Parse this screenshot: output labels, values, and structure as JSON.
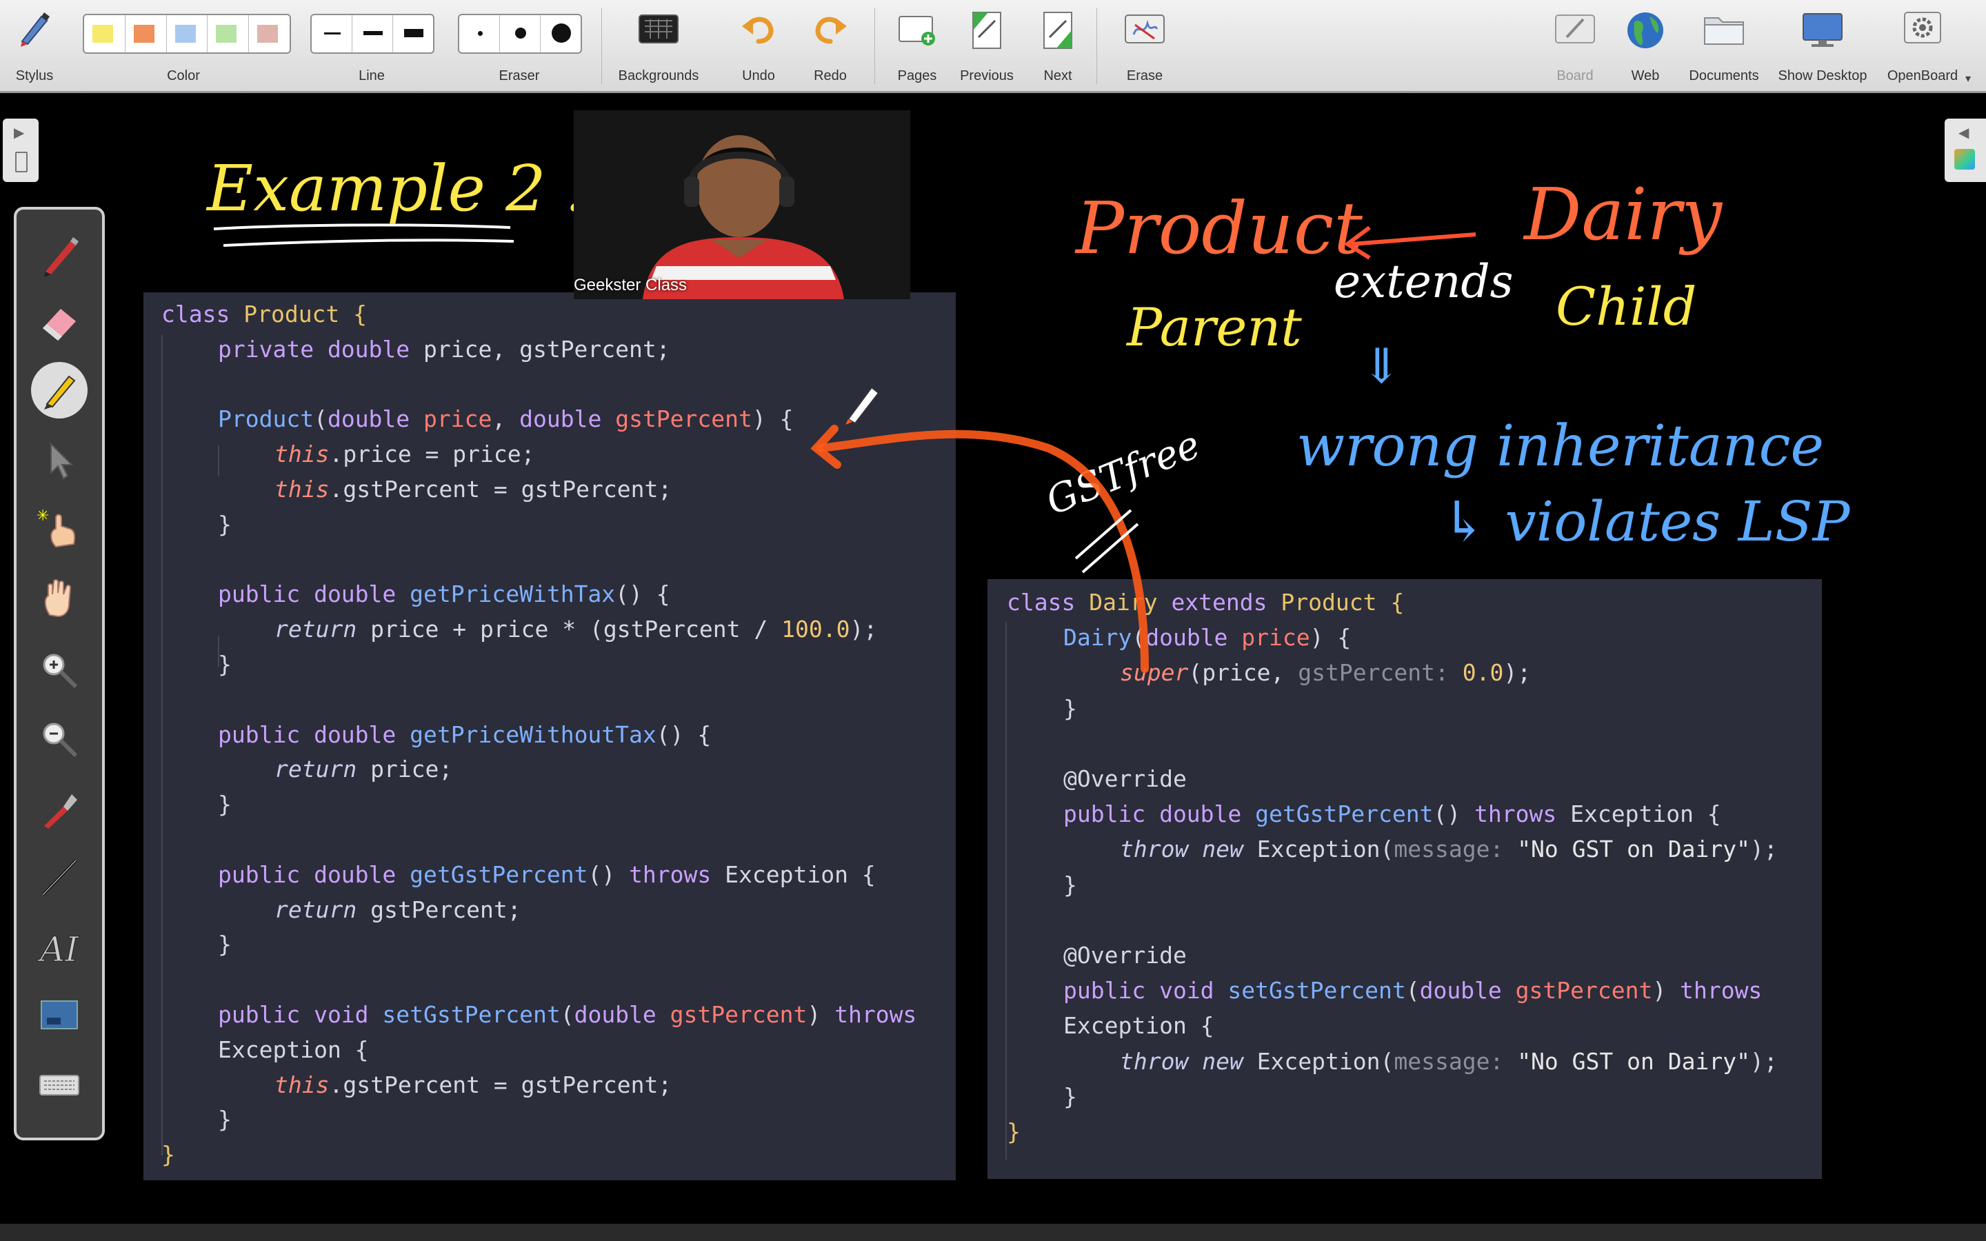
{
  "toolbar": {
    "stylus": "Stylus",
    "color": "Color",
    "line": "Line",
    "eraser": "Eraser",
    "backgrounds": "Backgrounds",
    "undo": "Undo",
    "redo": "Redo",
    "pages": "Pages",
    "previous": "Previous",
    "next": "Next",
    "erase": "Erase",
    "board": "Board",
    "web": "Web",
    "documents": "Documents",
    "show_desktop": "Show Desktop",
    "openboard": "OpenBoard",
    "colors": [
      "#f7ea6b",
      "#f0905a",
      "#a9c8f0",
      "#b7e4a4",
      "#e0b4ac"
    ]
  },
  "palette": {
    "tools": [
      "pen",
      "eraser",
      "marker",
      "selector",
      "laser-pointer",
      "hand",
      "zoom-in",
      "zoom-out",
      "capture",
      "line",
      "text",
      "screenshot",
      "keyboard"
    ]
  },
  "webcam": {
    "label": "Geekster Class"
  },
  "handwriting": {
    "title": "Example 2 :->",
    "product": "Product",
    "dairy": "Dairy",
    "extends": "extends",
    "parent": "Parent",
    "child": "Child",
    "down_arrow": "⇓",
    "wrong": "wrong inheritance",
    "violates": "↳ violates LSP",
    "gst_free": "GSTfree"
  },
  "code_left": {
    "lines": [
      {
        "indent": 0,
        "tokens": [
          [
            "kw",
            "class "
          ],
          [
            "ty",
            "Product"
          ],
          [
            "ty",
            " {"
          ]
        ]
      },
      {
        "indent": 1,
        "tokens": [
          [
            "kw",
            "private double "
          ],
          [
            "",
            "price, gstPercent;"
          ]
        ]
      },
      {
        "indent": 0,
        "tokens": []
      },
      {
        "indent": 1,
        "tokens": [
          [
            "fn",
            "Product"
          ],
          [
            "",
            "("
          ],
          [
            "kw",
            "double "
          ],
          [
            "pa",
            "price"
          ],
          [
            "",
            ", "
          ],
          [
            "kw",
            "double "
          ],
          [
            "pa",
            "gstPercent"
          ],
          [
            "",
            ") {"
          ]
        ]
      },
      {
        "indent": 2,
        "tokens": [
          [
            "it",
            "this"
          ],
          [
            "",
            ".price = price;"
          ]
        ]
      },
      {
        "indent": 2,
        "tokens": [
          [
            "it",
            "this"
          ],
          [
            "",
            ".gstPercent = gstPercent;"
          ]
        ]
      },
      {
        "indent": 1,
        "tokens": [
          [
            "",
            "}"
          ]
        ]
      },
      {
        "indent": 0,
        "tokens": []
      },
      {
        "indent": 1,
        "tokens": [
          [
            "kw",
            "public double "
          ],
          [
            "fn",
            "getPriceWithTax"
          ],
          [
            "",
            "() {"
          ]
        ]
      },
      {
        "indent": 2,
        "tokens": [
          [
            "ret",
            "return "
          ],
          [
            "",
            "price + price * (gstPercent / "
          ],
          [
            "num",
            "100.0"
          ],
          [
            "",
            ");"
          ]
        ]
      },
      {
        "indent": 1,
        "tokens": [
          [
            "",
            "}"
          ]
        ]
      },
      {
        "indent": 0,
        "tokens": []
      },
      {
        "indent": 1,
        "tokens": [
          [
            "kw",
            "public double "
          ],
          [
            "fn",
            "getPriceWithoutTax"
          ],
          [
            "",
            "() {"
          ]
        ]
      },
      {
        "indent": 2,
        "tokens": [
          [
            "ret",
            "return "
          ],
          [
            "",
            "price;"
          ]
        ]
      },
      {
        "indent": 1,
        "tokens": [
          [
            "",
            "}"
          ]
        ]
      },
      {
        "indent": 0,
        "tokens": []
      },
      {
        "indent": 1,
        "tokens": [
          [
            "kw",
            "public double "
          ],
          [
            "fn",
            "getGstPercent"
          ],
          [
            "",
            "() "
          ],
          [
            "kw",
            "throws "
          ],
          [
            "",
            "Exception {"
          ]
        ]
      },
      {
        "indent": 2,
        "tokens": [
          [
            "ret",
            "return "
          ],
          [
            "",
            "gstPercent;"
          ]
        ]
      },
      {
        "indent": 1,
        "tokens": [
          [
            "",
            "}"
          ]
        ]
      },
      {
        "indent": 0,
        "tokens": []
      },
      {
        "indent": 1,
        "tokens": [
          [
            "kw",
            "public void "
          ],
          [
            "fn",
            "setGstPercent"
          ],
          [
            "",
            "("
          ],
          [
            "kw",
            "double "
          ],
          [
            "pa",
            "gstPercent"
          ],
          [
            "",
            ") "
          ],
          [
            "kw",
            "throws"
          ]
        ]
      },
      {
        "indent": 1,
        "tokens": [
          [
            "",
            "Exception {"
          ]
        ]
      },
      {
        "indent": 2,
        "tokens": [
          [
            "it",
            "this"
          ],
          [
            "",
            ".gstPercent = gstPercent;"
          ]
        ]
      },
      {
        "indent": 1,
        "tokens": [
          [
            "",
            "}"
          ]
        ]
      },
      {
        "indent": 0,
        "tokens": [
          [
            "ty",
            "}"
          ]
        ]
      }
    ]
  },
  "code_right": {
    "lines": [
      {
        "indent": 0,
        "tokens": [
          [
            "kw",
            "class "
          ],
          [
            "ty",
            "Dairy "
          ],
          [
            "kw",
            "extends "
          ],
          [
            "ty",
            "Product {"
          ]
        ]
      },
      {
        "indent": 1,
        "tokens": [
          [
            "fn",
            "Dairy"
          ],
          [
            "",
            "("
          ],
          [
            "kw",
            "double "
          ],
          [
            "pa",
            "price"
          ],
          [
            "",
            ") {"
          ]
        ]
      },
      {
        "indent": 2,
        "tokens": [
          [
            "it",
            "super"
          ],
          [
            "",
            "(price, "
          ],
          [
            "hint",
            "gstPercent: "
          ],
          [
            "num",
            "0.0"
          ],
          [
            "",
            ");"
          ]
        ]
      },
      {
        "indent": 1,
        "tokens": [
          [
            "",
            "}"
          ]
        ]
      },
      {
        "indent": 0,
        "tokens": []
      },
      {
        "indent": 1,
        "tokens": [
          [
            "ann",
            "@Override"
          ]
        ]
      },
      {
        "indent": 1,
        "tokens": [
          [
            "kw",
            "public double "
          ],
          [
            "fn",
            "getGstPercent"
          ],
          [
            "",
            "() "
          ],
          [
            "kw",
            "throws "
          ],
          [
            "",
            "Exception {"
          ]
        ]
      },
      {
        "indent": 2,
        "tokens": [
          [
            "ret",
            "throw new "
          ],
          [
            "",
            "Exception("
          ],
          [
            "hint",
            "message: "
          ],
          [
            "str",
            "\"No GST on Dairy\""
          ],
          [
            "",
            ");"
          ]
        ]
      },
      {
        "indent": 1,
        "tokens": [
          [
            "",
            "}"
          ]
        ]
      },
      {
        "indent": 0,
        "tokens": []
      },
      {
        "indent": 1,
        "tokens": [
          [
            "ann",
            "@Override"
          ]
        ]
      },
      {
        "indent": 1,
        "tokens": [
          [
            "kw",
            "public void "
          ],
          [
            "fn",
            "setGstPercent"
          ],
          [
            "",
            "("
          ],
          [
            "kw",
            "double "
          ],
          [
            "pa",
            "gstPercent"
          ],
          [
            "",
            ") "
          ],
          [
            "kw",
            "throws"
          ]
        ]
      },
      {
        "indent": 1,
        "tokens": [
          [
            "",
            "Exception {"
          ]
        ]
      },
      {
        "indent": 2,
        "tokens": [
          [
            "ret",
            "throw new "
          ],
          [
            "",
            "Exception("
          ],
          [
            "hint",
            "message: "
          ],
          [
            "str",
            "\"No GST on Dairy\""
          ],
          [
            "",
            ");"
          ]
        ]
      },
      {
        "indent": 1,
        "tokens": [
          [
            "",
            "}"
          ]
        ]
      },
      {
        "indent": 0,
        "tokens": [
          [
            "ty",
            "}"
          ]
        ]
      }
    ]
  }
}
